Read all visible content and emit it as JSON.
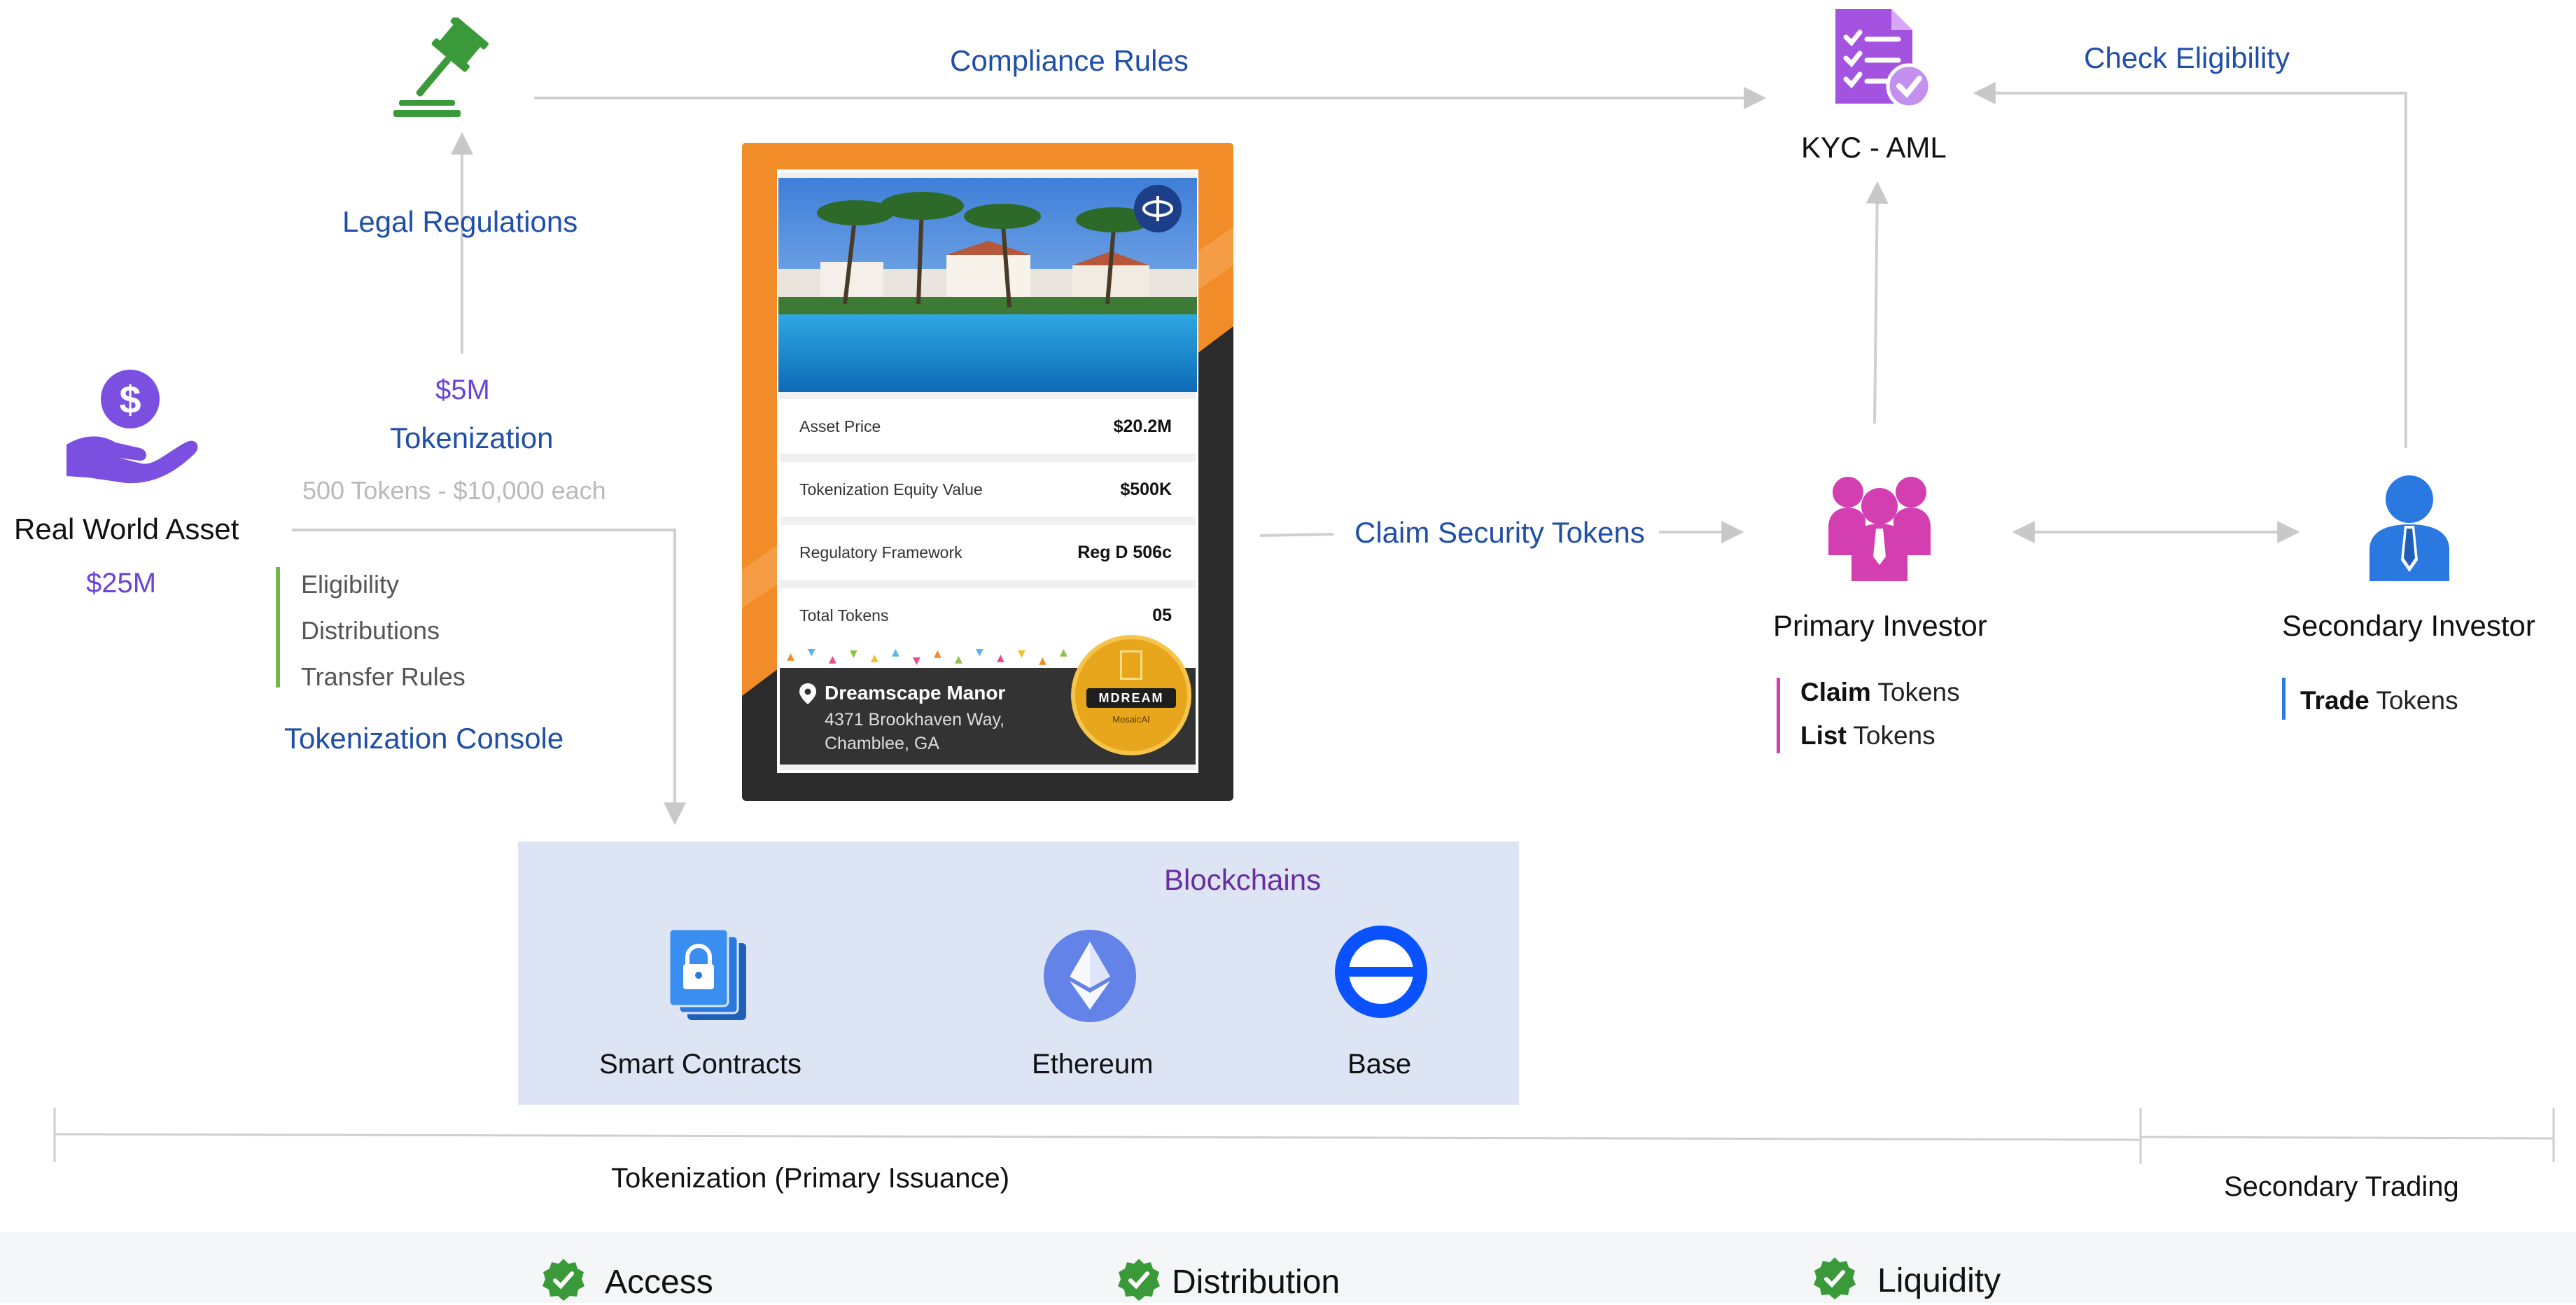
{
  "top": {
    "compliance_rules": "Compliance  Rules",
    "check_eligibility": "Check Eligibility",
    "kyc_aml": "KYC - AML",
    "legal_regulations": "Legal Regulations"
  },
  "asset": {
    "title": "Real World Asset",
    "value": "$25M"
  },
  "tokenization": {
    "amount": "$5M",
    "title": "Tokenization",
    "detail": "500 Tokens - $10,000 each"
  },
  "console": {
    "items": [
      "Eligibility",
      "Distributions",
      "Transfer Rules"
    ],
    "title": "Tokenization Console"
  },
  "card": {
    "rows": [
      {
        "label": "Asset Price",
        "value": "$20.2M"
      },
      {
        "label": "Tokenization Equity Value",
        "value": "$500K"
      },
      {
        "label": "Regulatory Framework",
        "value": "Reg D 506c"
      },
      {
        "label": "Total Tokens",
        "value": "05"
      }
    ],
    "property_name": "Dreamscape Manor",
    "address_line1": "4371 Brookhaven Way,",
    "address_line2": "Chamblee, GA",
    "badge_text": "MDREAM",
    "badge_sub": "MosaicAI"
  },
  "claim": "Claim Security Tokens",
  "primary": {
    "title": "Primary Investor",
    "items": [
      {
        "bold": "Claim",
        "rest": " Tokens"
      },
      {
        "bold": "List",
        "rest": " Tokens"
      }
    ]
  },
  "secondary": {
    "title": "Secondary Investor",
    "items": [
      {
        "bold": "Trade",
        "rest": " Tokens"
      }
    ]
  },
  "blockchains": {
    "title": "Blockchains",
    "items": [
      "Smart Contracts",
      "Ethereum",
      "Base"
    ]
  },
  "phases": {
    "primary": "Tokenization (Primary Issuance)",
    "secondary": "Secondary Trading"
  },
  "benefits": [
    "Access",
    "Distribution",
    "Liquidity"
  ],
  "colors": {
    "blue_text": "#1f4fa8",
    "purple_text": "#6a44d6",
    "orange": "#f28c28",
    "dark": "#2b2b2b",
    "magenta": "#d33fb0",
    "investor_blue": "#2a79e0",
    "green": "#3a9a3a",
    "panel": "#dde5f4"
  }
}
